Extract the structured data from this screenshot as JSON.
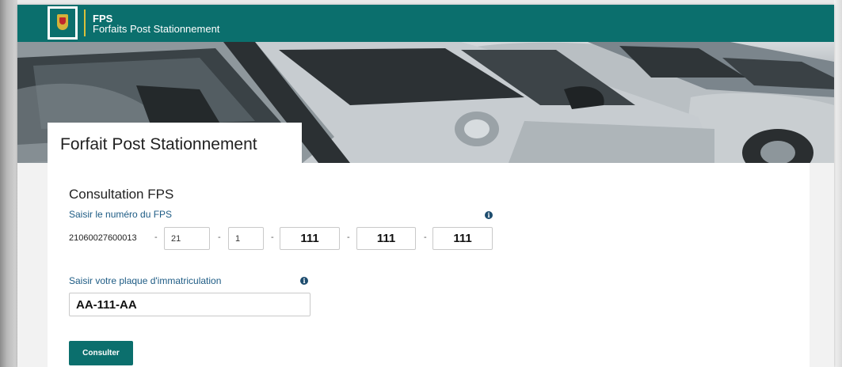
{
  "header": {
    "title": "FPS",
    "subtitle": "Forfaits Post Stationnement"
  },
  "hero": {
    "title": "Forfait Post Stationnement"
  },
  "form": {
    "section_title": "Consultation FPS",
    "fps_label": "Saisir le numéro du FPS",
    "fps_prefix": "21060027600013",
    "fps_separator": "-",
    "fps_fields": [
      "21",
      "1",
      "111",
      "111",
      "111"
    ],
    "plate_label": "Saisir votre plaque d'immatriculation",
    "plate_value": "AA-111-AA",
    "submit_label": "Consulter"
  },
  "icons": {
    "info": "i"
  },
  "colors": {
    "brand": "#0b6f6d",
    "accent_gold": "#d8c03a",
    "label_blue": "#1d5b84"
  }
}
